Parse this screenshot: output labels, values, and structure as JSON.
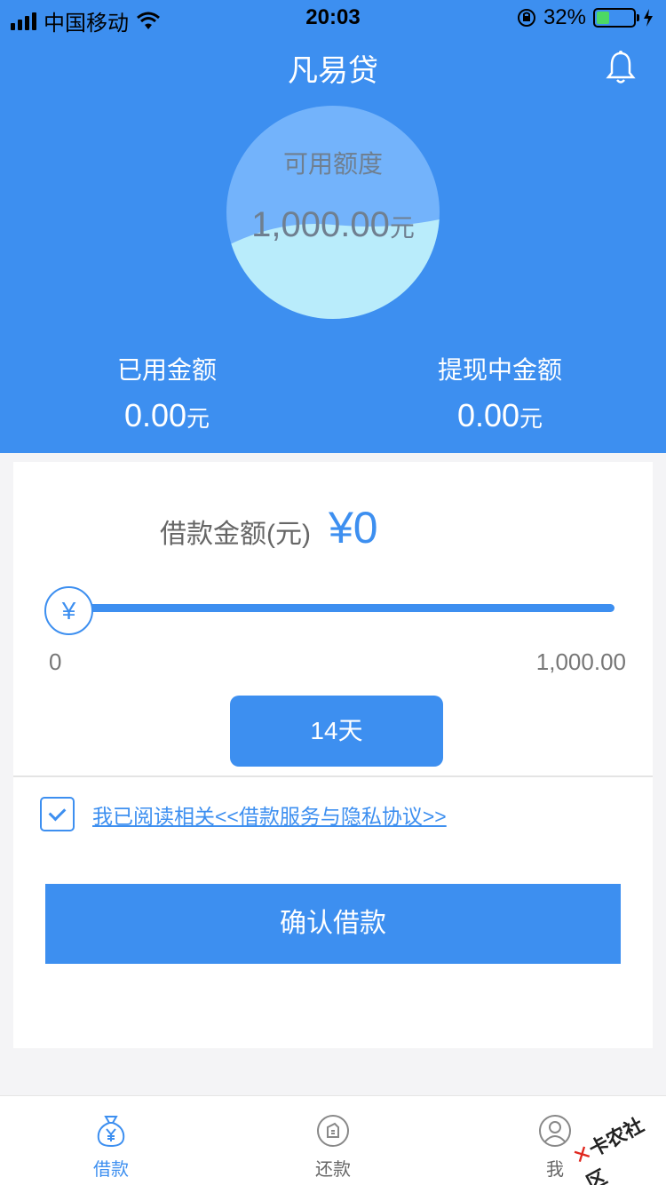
{
  "status_bar": {
    "carrier": "中国移动",
    "time": "20:03",
    "battery": "32%"
  },
  "header": {
    "title": "凡易贷"
  },
  "credit": {
    "label": "可用额度",
    "amount": "1,000.00",
    "unit": "元"
  },
  "stats": {
    "used": {
      "label": "已用金额",
      "value": "0.00",
      "unit": "元"
    },
    "withdrawing": {
      "label": "提现中金额",
      "value": "0.00",
      "unit": "元"
    }
  },
  "loan": {
    "amount_label": "借款金额(元)",
    "amount_value": "¥0",
    "slider_thumb": "¥",
    "slider_fraction": 0,
    "range_min": "0",
    "range_max": "1,000.00",
    "term_label": "14天",
    "agreement_text": "我已阅读相关<<借款服务与隐私协议>>",
    "agreement_checked": true,
    "confirm_label": "确认借款"
  },
  "tabbar": {
    "items": [
      {
        "label": "借款",
        "icon": "money-bag-icon",
        "active": true
      },
      {
        "label": "还款",
        "icon": "repay-icon",
        "active": false
      },
      {
        "label": "我",
        "icon": "user-icon",
        "active": false
      }
    ]
  },
  "watermark": {
    "text": "卡农社区"
  },
  "colors": {
    "primary": "#3d8ff0",
    "circle": "#73b3fb",
    "wave": "#b9ecfb"
  }
}
